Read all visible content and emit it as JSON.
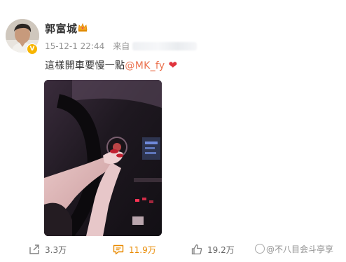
{
  "post": {
    "author": {
      "name": "郭富城",
      "avatar_icon": "user-avatar",
      "badge_icon": "crown-icon",
      "verified_icon": "verified-icon",
      "verified_color": "#f7b500"
    },
    "timestamp": "15-12-1 22:44",
    "source_prefix": "来自",
    "text": "這樣開車要慢一點",
    "mention": "@MK_fy",
    "mention_color": "#eb7350",
    "emoji": "❤",
    "media": {
      "type": "video-thumbnail"
    }
  },
  "actions": {
    "repost": {
      "icon": "share-icon",
      "count": "3.3万"
    },
    "comment": {
      "icon": "comment-icon",
      "count": "11.9万",
      "color": "#e98a00"
    },
    "like": {
      "icon": "thumbs-up-icon",
      "count": "19.2万"
    }
  },
  "watermark": {
    "text": "@不八目会斗亭享"
  }
}
